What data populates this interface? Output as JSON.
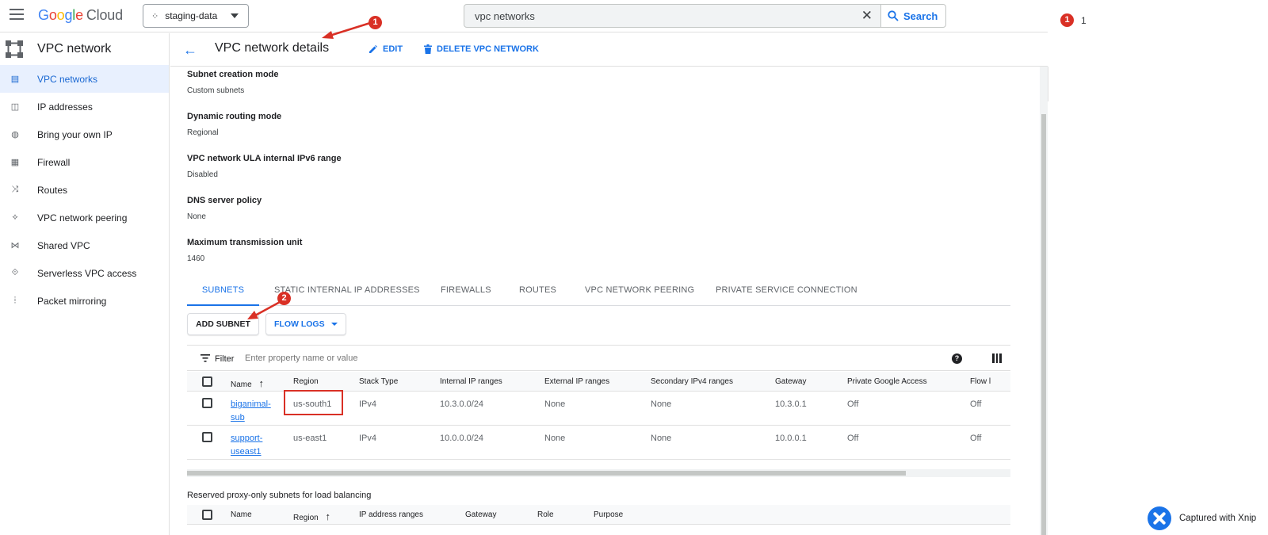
{
  "topbar": {
    "brand": [
      "G",
      "o",
      "o",
      "g",
      "l",
      "e"
    ],
    "brand_suffix": "Cloud",
    "project": "staging-data",
    "search_value": "vpc networks",
    "search_label": "Search",
    "notification_badge": "1",
    "notification_count": "1"
  },
  "sidebar": {
    "title": "VPC network",
    "items": [
      {
        "label": "VPC networks",
        "icon": "vpc-networks-icon"
      },
      {
        "label": "IP addresses",
        "icon": "ip-address-icon"
      },
      {
        "label": "Bring your own IP",
        "icon": "globe-icon"
      },
      {
        "label": "Firewall",
        "icon": "firewall-icon"
      },
      {
        "label": "Routes",
        "icon": "routes-icon"
      },
      {
        "label": "VPC network peering",
        "icon": "peering-icon"
      },
      {
        "label": "Shared VPC",
        "icon": "shared-vpc-icon"
      },
      {
        "label": "Serverless VPC access",
        "icon": "serverless-icon"
      },
      {
        "label": "Packet mirroring",
        "icon": "packet-mirroring-icon"
      }
    ]
  },
  "header": {
    "title": "VPC network details",
    "edit_label": "EDIT",
    "delete_label": "DELETE VPC NETWORK"
  },
  "properties": [
    {
      "label": "Subnet creation mode",
      "value": "Custom subnets"
    },
    {
      "label": "Dynamic routing mode",
      "value": "Regional"
    },
    {
      "label": "VPC network ULA internal IPv6 range",
      "value": "Disabled"
    },
    {
      "label": "DNS server policy",
      "value": "None"
    },
    {
      "label": "Maximum transmission unit",
      "value": "1460"
    }
  ],
  "tabs": [
    "SUBNETS",
    "STATIC INTERNAL IP ADDRESSES",
    "FIREWALLS",
    "ROUTES",
    "VPC NETWORK PEERING",
    "PRIVATE SERVICE CONNECTION"
  ],
  "actions": {
    "add_subnet": "ADD SUBNET",
    "flow_logs": "FLOW LOGS"
  },
  "filter": {
    "label": "Filter",
    "placeholder": "Enter property name or value"
  },
  "subnets_table": {
    "columns": [
      "Name",
      "Region",
      "Stack Type",
      "Internal IP ranges",
      "External IP ranges",
      "Secondary IPv4 ranges",
      "Gateway",
      "Private Google Access",
      "Flow l"
    ],
    "rows": [
      {
        "name": "biganimal-sub",
        "region": "us-south1",
        "stack": "IPv4",
        "internal": "10.3.0.0/24",
        "external": "None",
        "secondary": "None",
        "gateway": "10.3.0.1",
        "pga": "Off",
        "flow": "Off"
      },
      {
        "name": "support-useast1",
        "region": "us-east1",
        "stack": "IPv4",
        "internal": "10.0.0.0/24",
        "external": "None",
        "secondary": "None",
        "gateway": "10.0.0.1",
        "pga": "Off",
        "flow": "Off"
      }
    ]
  },
  "reserved": {
    "title": "Reserved proxy-only subnets for load balancing",
    "columns": [
      "Name",
      "Region",
      "IP address ranges",
      "Gateway",
      "Role",
      "Purpose"
    ]
  },
  "annotations": [
    "1",
    "2"
  ],
  "watermark": "Captured with Xnip",
  "colors": {
    "accent": "#1a73e8",
    "annotation": "#d93025",
    "active_bg": "#e8f0fe"
  }
}
